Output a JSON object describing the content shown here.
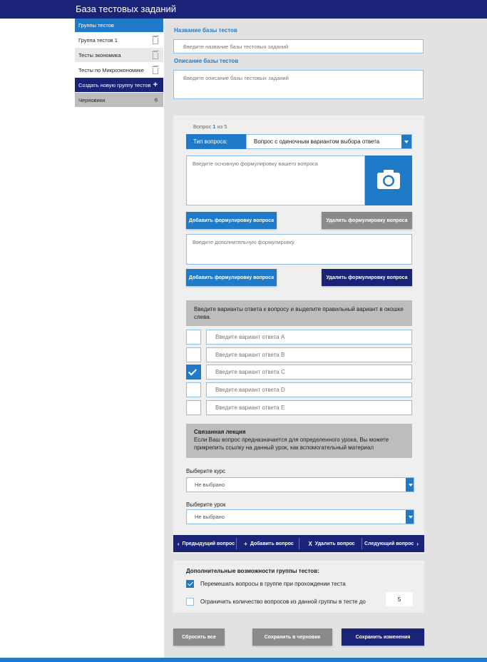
{
  "header": {
    "title": "База тестовых заданий"
  },
  "sidebar": {
    "heading": "Группы тестов",
    "groups": [
      {
        "label": "Группа тестов 1"
      },
      {
        "label": "Тесты экономика"
      },
      {
        "label": "Тесты по Микроэкономике"
      }
    ],
    "create_label": "Создать новую группу тестов",
    "create_icon": "+",
    "drafts_label": "Черновики",
    "drafts_count": "6"
  },
  "base": {
    "name_label": "Название базы тестов",
    "name_placeholder": "Введите название базы тестовых заданий",
    "desc_label": "Описание базы тестов",
    "desc_placeholder": "Введите описание базы тестовых заданий"
  },
  "question": {
    "counter_prefix": "Вопрос",
    "current": "1",
    "counter_mid": "из",
    "total": "5",
    "type_label": "Тип вопроса:",
    "type_value": "Вопрос с одиночным вариантом выбора ответа",
    "main_placeholder": "Введите основную формулировку вашего вопроса",
    "add_formulation": "Добавить формулировку вопроса",
    "delete_formulation": "Удалить формулировку вопроса",
    "extra_placeholder": "Введите дополнительную формулировку",
    "answers_hint": "Введите варианты ответа к вопросу и выделите правильный вариант в окошке слева.",
    "answers": [
      {
        "placeholder": "Введите вариант ответа A",
        "checked": false
      },
      {
        "placeholder": "Введите вариант ответа B",
        "checked": false
      },
      {
        "placeholder": "Введите вариант ответа C",
        "checked": true
      },
      {
        "placeholder": "Введите вариант ответа D",
        "checked": false
      },
      {
        "placeholder": "Введите вариант ответа E",
        "checked": false
      }
    ],
    "lecture_title": "Связанная лекция",
    "lecture_text": "Если Ваш вопрос предназначается для определенного урока, Вы можете прикрепить ссылку на данный урок, как вспомогательный материал",
    "course_label": "Выберите курс",
    "course_value": "Не выбрано",
    "lesson_label": "Выберите урок",
    "lesson_value": "Не выбрано"
  },
  "nav": {
    "prev": "Предыдущий вопрос",
    "add": "Добавить вопрос",
    "delete": "Удалить вопрос",
    "next": "Следующий вопрос"
  },
  "extra": {
    "title": "Дополнительные возможности группы тестов:",
    "shuffle_label": "Перемешать вопросы в группе при прохождении теста",
    "shuffle_checked": true,
    "limit_label": "Ограничить количество вопросов из данной группы в тесте до",
    "limit_checked": false,
    "limit_value": "5"
  },
  "footer": {
    "reset": "Сбросить все",
    "save_draft": "Сохранить в черновик",
    "save": "Сохранить изменения"
  },
  "colors": {
    "navy": "#1b2378",
    "blue": "#1f7bc8",
    "grey_button": "#8a8a8a",
    "panel_bg": "#e2e2e2"
  }
}
